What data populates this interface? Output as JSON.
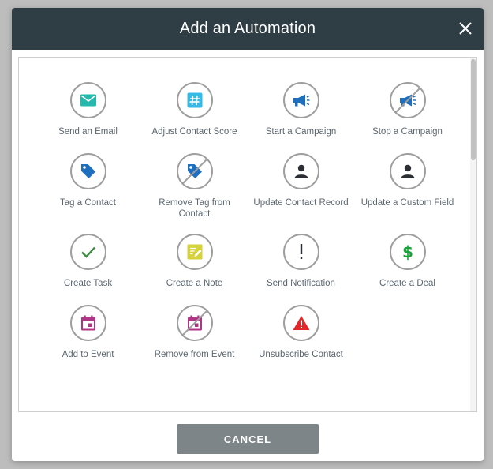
{
  "dialog": {
    "title": "Add an Automation",
    "close_icon": "close-icon"
  },
  "actions": [
    {
      "label": "Send an Email",
      "icon": "email-icon",
      "color": "#26b9ad"
    },
    {
      "label": "Adjust Contact Score",
      "icon": "hash-icon",
      "color": "#35b9e6"
    },
    {
      "label": "Start a Campaign",
      "icon": "megaphone-icon",
      "color": "#1f6fbf"
    },
    {
      "label": "Stop a Campaign",
      "icon": "megaphone-off-icon",
      "color": "#1f6fbf"
    },
    {
      "label": "Tag a Contact",
      "icon": "tag-icon",
      "color": "#1f6fbf"
    },
    {
      "label": "Remove Tag from Contact",
      "icon": "tag-off-icon",
      "color": "#1f6fbf"
    },
    {
      "label": "Update Contact Record",
      "icon": "person-icon",
      "color": "#2b2f33"
    },
    {
      "label": "Update a Custom Field",
      "icon": "person-icon",
      "color": "#2b2f33"
    },
    {
      "label": "Create Task",
      "icon": "checkmark-icon",
      "color": "#3a8d3e"
    },
    {
      "label": "Create a Note",
      "icon": "note-icon",
      "color": "#d5d23a"
    },
    {
      "label": "Send Notification",
      "icon": "exclamation-icon",
      "color": "#2b2f33"
    },
    {
      "label": "Create a Deal",
      "icon": "dollar-icon",
      "color": "#19a23a"
    },
    {
      "label": "Add to Event",
      "icon": "calendar-icon",
      "color": "#b03585"
    },
    {
      "label": "Remove from Event",
      "icon": "calendar-off-icon",
      "color": "#b03585"
    },
    {
      "label": "Unsubscribe Contact",
      "icon": "warning-icon",
      "color": "#e2262a"
    }
  ],
  "footer": {
    "cancel_label": "CANCEL"
  },
  "colors": {
    "header": "#2f3d45",
    "circle_border": "#9e9e9e",
    "label_text": "#5b6770",
    "cancel_button": "#7d8589"
  }
}
